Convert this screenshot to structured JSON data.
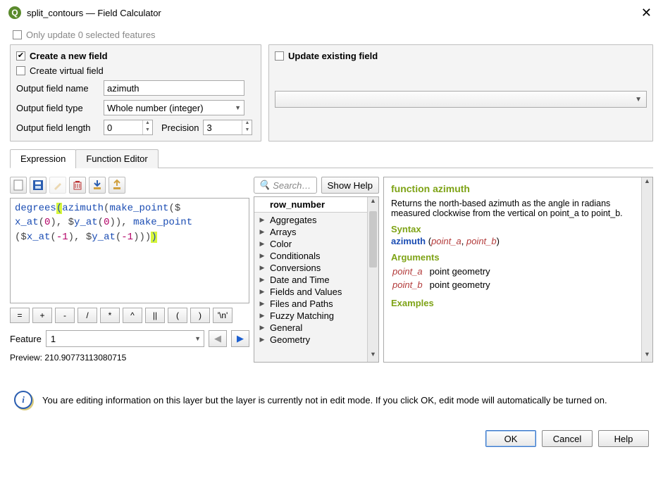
{
  "window": {
    "title": "split_contours — Field Calculator"
  },
  "top": {
    "only_update_label": "Only update 0 selected features"
  },
  "left_group": {
    "create_new_field": "Create a new field",
    "create_virtual_field": "Create virtual field",
    "output_field_name_label": "Output field name",
    "output_field_name_value": "azimuth",
    "output_field_type_label": "Output field type",
    "output_field_type_value": "Whole number (integer)",
    "output_field_length_label": "Output field length",
    "output_field_length_value": "0",
    "precision_label": "Precision",
    "precision_value": "3"
  },
  "right_group": {
    "update_existing_field": "Update existing field"
  },
  "tabs": {
    "expression": "Expression",
    "function_editor": "Function Editor"
  },
  "expression": {
    "code_html": "<span class='fn'>degrees</span><span class='hl'>(</span><span class='fn'>azimuth</span><span class='punct'>(</span><span class='fn'>make_point</span><span class='punct'>(</span><span class='punct'>$</span><br><span class='fn'>x_at</span><span class='punct'>(</span><span class='num'>0</span><span class='punct'>)</span><span class='punct'>,</span> <span class='punct'>$</span><span class='fn'>y_at</span><span class='punct'>(</span><span class='num'>0</span><span class='punct'>))</span><span class='punct'>,</span> <span class='fn'>make_point</span><br><span class='punct'>(</span><span class='punct'>$</span><span class='fn'>x_at</span><span class='punct'>(</span><span class='num'>-1</span><span class='punct'>)</span><span class='punct'>,</span> <span class='punct'>$</span><span class='fn'>y_at</span><span class='punct'>(</span><span class='num'>-1</span><span class='punct'>))</span><span class='punct'>)</span><span class='hl'>)</span>",
    "ops": [
      "=",
      "+",
      "-",
      "/",
      "*",
      "^",
      "||",
      "(",
      ")",
      "'\\n'"
    ],
    "feature_label": "Feature",
    "feature_value": "1",
    "preview_label": "Preview:",
    "preview_value": "210.90773113080715"
  },
  "functions": {
    "search_placeholder": "Search…",
    "show_help": "Show Help",
    "header": "row_number",
    "categories": [
      "Aggregates",
      "Arrays",
      "Color",
      "Conditionals",
      "Conversions",
      "Date and Time",
      "Fields and Values",
      "Files and Paths",
      "Fuzzy Matching",
      "General",
      "Geometry"
    ]
  },
  "help": {
    "title": "function azimuth",
    "desc": "Returns the north-based azimuth as the angle in radians measured clockwise from the vertical on point_a to point_b.",
    "syntax_label": "Syntax",
    "syntax_fn": "azimuth",
    "syntax_args": [
      "point_a",
      "point_b"
    ],
    "arguments_label": "Arguments",
    "args": [
      {
        "name": "point_a",
        "desc": "point geometry"
      },
      {
        "name": "point_b",
        "desc": "point geometry"
      }
    ],
    "examples_label": "Examples"
  },
  "info": {
    "text": "You are editing information on this layer but the layer is currently not in edit mode. If you click OK, edit mode will automatically be turned on."
  },
  "buttons": {
    "ok": "OK",
    "cancel": "Cancel",
    "help": "Help"
  }
}
